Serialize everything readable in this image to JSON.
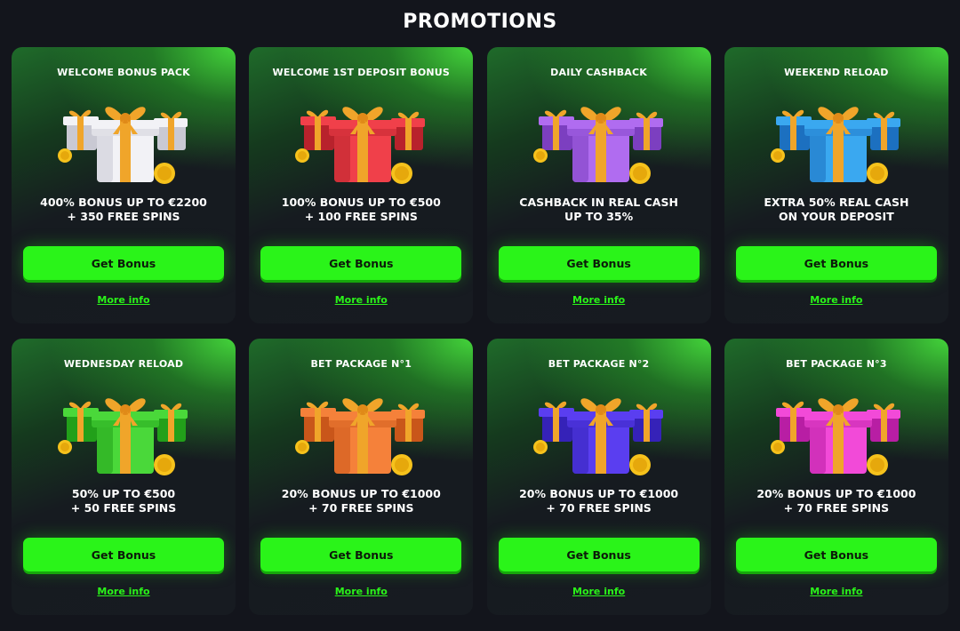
{
  "page": {
    "title": "PROMOTIONS"
  },
  "promotions": [
    {
      "title": "WELCOME BONUS PACK",
      "desc_line1": "400% BONUS UP TO €2200",
      "desc_line2": "+ 350 FREE SPINS",
      "button_label": "Get Bonus",
      "link_label": "More info",
      "gift_color": "#f2f2f6",
      "gift_shade": "#c9c9d3"
    },
    {
      "title": "WELCOME 1ST DEPOSIT BONUS",
      "desc_line1": "100% BONUS UP TO €500",
      "desc_line2": "+ 100 FREE SPINS",
      "button_label": "Get Bonus",
      "link_label": "More info",
      "gift_color": "#f0404a",
      "gift_shade": "#b8222c"
    },
    {
      "title": "DAILY CASHBACK",
      "desc_line1": "CASHBACK IN REAL CASH",
      "desc_line2": "UP TO 35%",
      "button_label": "Get Bonus",
      "link_label": "More info",
      "gift_color": "#b06cf0",
      "gift_shade": "#7c3fc0"
    },
    {
      "title": "WEEKEND RELOAD",
      "desc_line1": "EXTRA 50% REAL CASH",
      "desc_line2": "ON YOUR DEPOSIT",
      "button_label": "Get Bonus",
      "link_label": "More info",
      "gift_color": "#3aa8f0",
      "gift_shade": "#1c70c0"
    },
    {
      "title": "WEDNESDAY RELOAD",
      "desc_line1": "50% UP TO €500",
      "desc_line2": "+ 50 FREE SPINS",
      "button_label": "Get Bonus",
      "link_label": "More info",
      "gift_color": "#4ad83a",
      "gift_shade": "#22a01a"
    },
    {
      "title": "BET PACKAGE N°1",
      "desc_line1": "20% BONUS UP TO €1000",
      "desc_line2": "+ 70 FREE SPINS",
      "button_label": "Get Bonus",
      "link_label": "More info",
      "gift_color": "#f5813a",
      "gift_shade": "#c9561a"
    },
    {
      "title": "BET PACKAGE N°2",
      "desc_line1": "20% BONUS UP TO €1000",
      "desc_line2": "+ 70 FREE SPINS",
      "button_label": "Get Bonus",
      "link_label": "More info",
      "gift_color": "#5a3ef0",
      "gift_shade": "#3522b8"
    },
    {
      "title": "BET PACKAGE N°3",
      "desc_line1": "20% BONUS UP TO €1000",
      "desc_line2": "+ 70 FREE SPINS",
      "button_label": "Get Bonus",
      "link_label": "More info",
      "gift_color": "#f24ad8",
      "gift_shade": "#b81ea4"
    }
  ],
  "colors": {
    "accent_green": "#2af419",
    "background": "#13151c",
    "ribbon": "#f0a52a",
    "coin": "#f6c21c"
  },
  "icons": {
    "gift": "gift-icon",
    "coin": "coin-icon"
  }
}
